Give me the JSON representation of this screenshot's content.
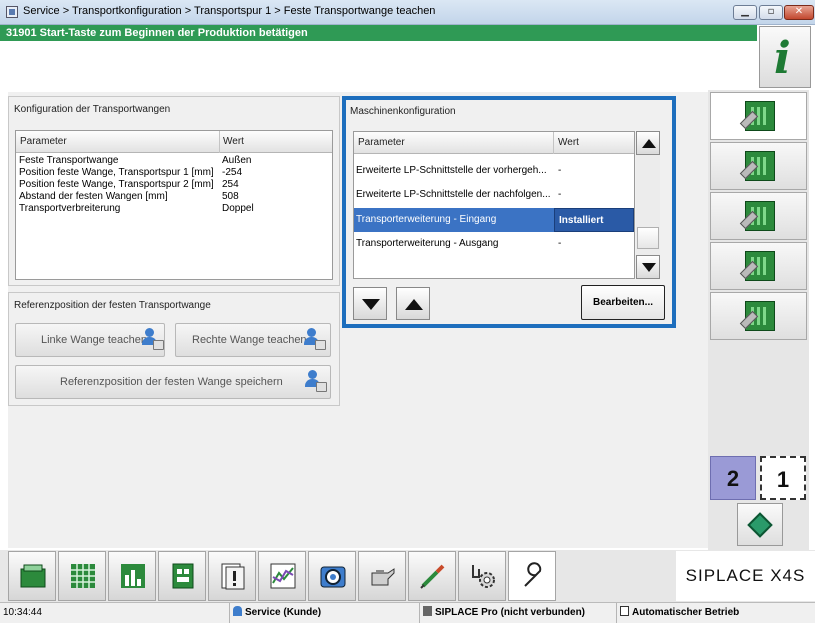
{
  "window": {
    "title": "Service > Transportkonfiguration > Transportspur 1 > Feste Transportwange teachen"
  },
  "banner": {
    "message": "31901 Start-Taste zum Beginnen der Produktion betätigen"
  },
  "info_button": {
    "glyph": "i"
  },
  "left_panel": {
    "title": "Konfiguration der Transportwangen",
    "headers": {
      "param": "Parameter",
      "value": "Wert"
    },
    "rows": [
      {
        "param": "Feste Transportwange",
        "value": "Außen"
      },
      {
        "param": "Position feste Wange, Transportspur 1 [mm]",
        "value": "-254"
      },
      {
        "param": "Position feste Wange, Transportspur 2 [mm]",
        "value": "254"
      },
      {
        "param": "Abstand der festen Wangen [mm]",
        "value": "508"
      },
      {
        "param": "Transportverbreiterung",
        "value": "Doppel"
      }
    ]
  },
  "reference_panel": {
    "title": "Referenzposition der festen Transportwange",
    "left_button": "Linke Wange teachen",
    "right_button": "Rechte Wange teachen",
    "save_button": "Referenzposition der festen Wange speichern"
  },
  "machine_panel": {
    "title": "Maschinenkonfiguration",
    "headers": {
      "param": "Parameter",
      "value": "Wert"
    },
    "rows": [
      {
        "param": "Erweiterte LP-Schnittstelle der vorhergeh...",
        "value": "-",
        "selected": false
      },
      {
        "param": "Erweiterte LP-Schnittstelle der nachfolgen...",
        "value": "-",
        "selected": false
      },
      {
        "param": "Transporterweiterung - Eingang",
        "value": "Installiert",
        "selected": true
      },
      {
        "param": "Transporterweiterung - Ausgang",
        "value": "-",
        "selected": false
      }
    ],
    "edit_button": "Bearbeiten...",
    "selection_color": "#3b73c4",
    "frame_color": "#1d6ebd"
  },
  "sidebar": {
    "items": [
      {
        "icon": "transport-config-icon",
        "active": true
      },
      {
        "icon": "conveyor-board-icon",
        "active": false
      },
      {
        "icon": "conveyor-width-icon",
        "active": false
      },
      {
        "icon": "conveyor-adjust-icon",
        "active": false
      },
      {
        "icon": "conveyor-settings-icon",
        "active": false
      }
    ],
    "station_2": "2",
    "station_1": "1",
    "nav_icon": "navigate-arrow-icon"
  },
  "toolbar": {
    "items": [
      {
        "icon": "production-icon"
      },
      {
        "icon": "feeder-grid-icon"
      },
      {
        "icon": "statistics-icon"
      },
      {
        "icon": "board-icon"
      },
      {
        "icon": "warning-report-icon"
      },
      {
        "icon": "chart-trend-icon"
      },
      {
        "icon": "camera-icon"
      },
      {
        "icon": "oil-can-icon"
      },
      {
        "icon": "nozzle-tool-icon"
      },
      {
        "icon": "gear-hand-icon"
      },
      {
        "icon": "service-wrench-icon"
      }
    ],
    "brand": "SIPLACE  X4S"
  },
  "statusbar": {
    "time": "10:34:44",
    "user": "Service (Kunde)",
    "connection": "SIPLACE Pro (nicht verbunden)",
    "mode": "Automatischer Betrieb"
  }
}
